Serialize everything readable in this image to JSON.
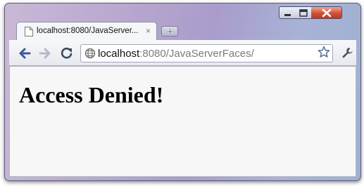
{
  "tab": {
    "title": "localhost:8080/JavaServer...",
    "close_glyph": "×",
    "icon": "page-icon"
  },
  "toolbar": {
    "back_icon": "back-arrow-icon",
    "forward_icon": "forward-arrow-icon",
    "reload_icon": "reload-icon",
    "bookmark_icon": "star-icon",
    "menu_icon": "wrench-icon"
  },
  "address": {
    "host": "localhost",
    "path": ":8080/JavaServerFaces/",
    "icon": "globe-icon"
  },
  "page": {
    "heading": "Access Denied!"
  },
  "colors": {
    "frame": "#b9a8cf",
    "close_button": "#c1381f",
    "nav_arrow": "#3b5a94",
    "content_background": "#f7f7f7"
  }
}
